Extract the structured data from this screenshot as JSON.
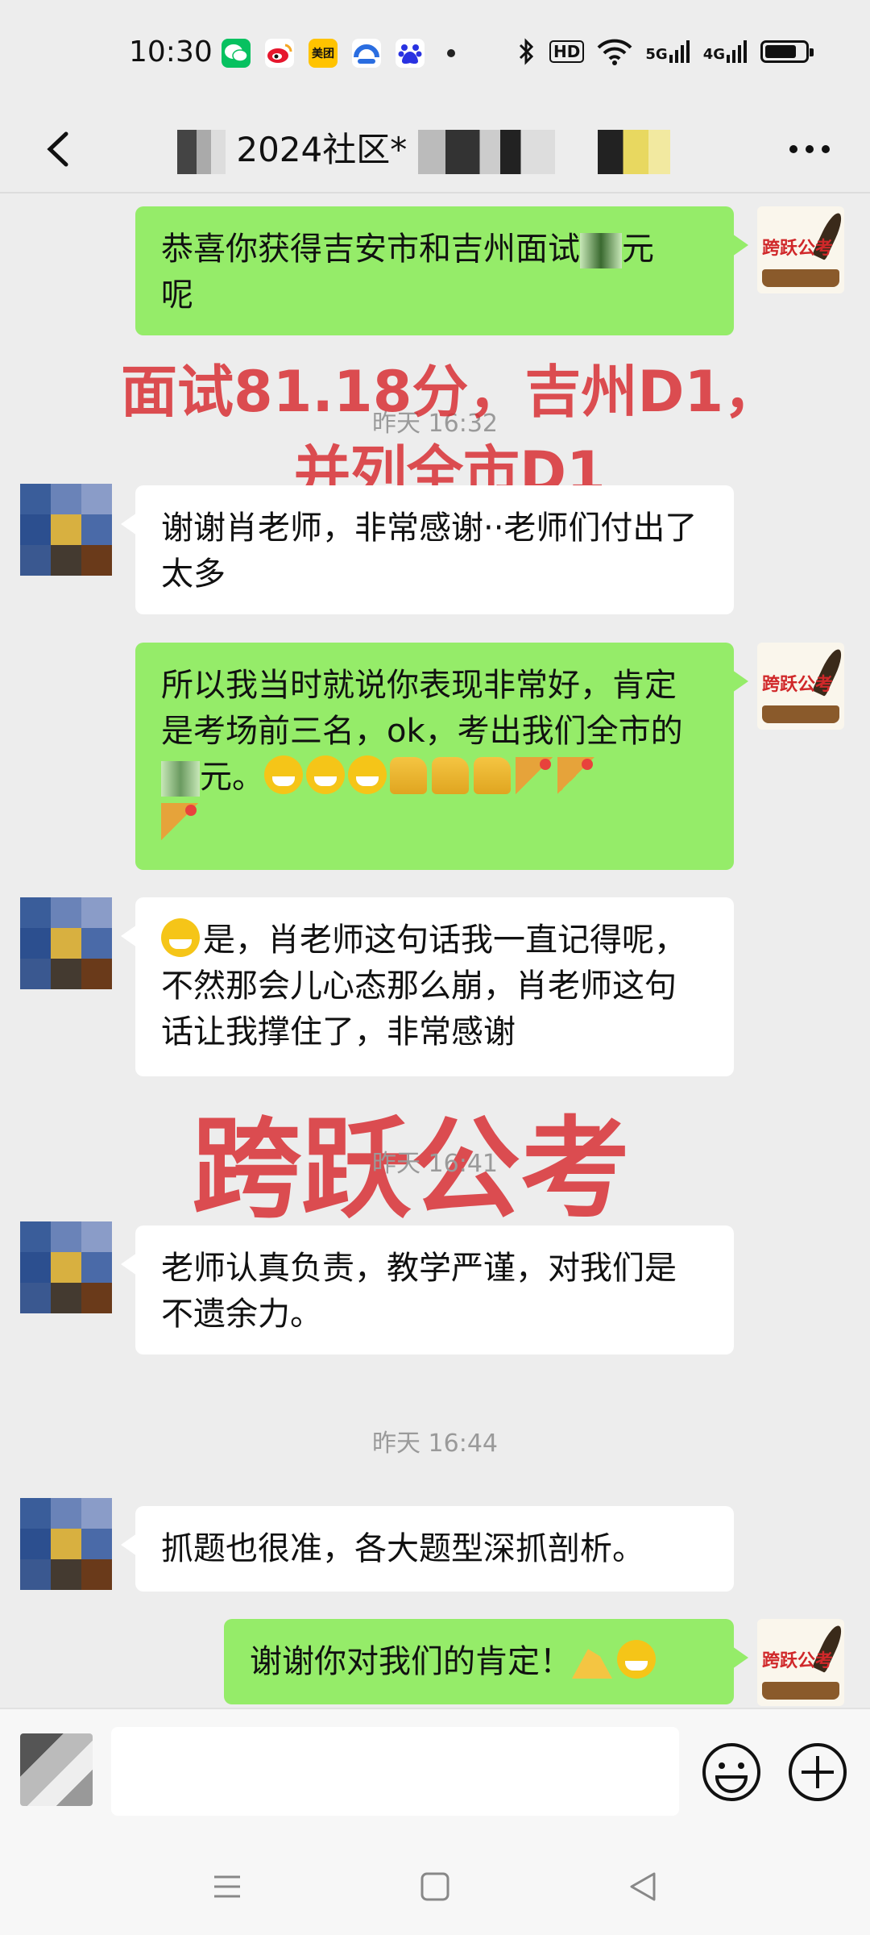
{
  "status_bar": {
    "time": "10:30",
    "app_icons": [
      {
        "name": "wechat-icon",
        "color": "#07c160"
      },
      {
        "name": "weibo-icon",
        "color": "#e6162d"
      },
      {
        "name": "meituan-icon",
        "color": "#ffc300",
        "label": "美团"
      },
      {
        "name": "app-blue-icon",
        "color": "#2a6de0"
      },
      {
        "name": "baidu-icon",
        "color": "#2932e1"
      }
    ],
    "hd_badge": "HD",
    "net1": "5G",
    "net2": "4G",
    "battery_level": 0.8
  },
  "header": {
    "title": "2024社区*",
    "back_icon": "back-icon",
    "more_icon": "more-icon"
  },
  "messages": [
    {
      "sender": "me",
      "text": "恭喜你获得吉安市和吉州面试",
      "text_suffix": "元",
      "text_line2": "呢"
    },
    {
      "type": "timestamp",
      "text": "昨天 16:32"
    },
    {
      "sender": "them",
      "text": "谢谢肖老师，非常感谢··老师们付出了太多"
    },
    {
      "sender": "me",
      "text": "所以我当时就说你表现非常好，肯定是考场前三名，ok，考出我们全市的",
      "text_suffix": "元。"
    },
    {
      "sender": "them",
      "text": "是，肖老师这句话我一直记得呢，不然那会儿心态那么崩，肖老师这句话让我撑住了，非常感谢"
    },
    {
      "type": "timestamp",
      "text": "昨天 16:41"
    },
    {
      "sender": "them",
      "text": "老师认真负责，教学严谨，对我们是不遗余力。"
    },
    {
      "type": "timestamp",
      "text": "昨天 16:44"
    },
    {
      "sender": "them",
      "text": "抓题也很准，各大题型深抓剖析。"
    },
    {
      "sender": "me",
      "text": "谢谢你对我们的肯定！"
    }
  ],
  "watermarks": {
    "line1": "面试81.18分，吉州D1，",
    "line2": "并列全市D1",
    "brand": "跨跃公考"
  },
  "avatar_me_label": "跨跃公考",
  "input": {
    "placeholder": "",
    "emoji_icon": "emoji-icon",
    "plus_icon": "plus-icon"
  },
  "nav": [
    "menu-icon",
    "home-icon",
    "back-nav-icon"
  ]
}
